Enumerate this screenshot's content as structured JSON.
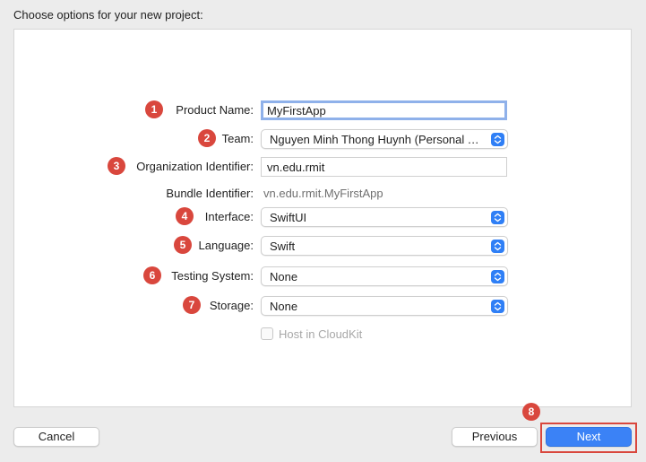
{
  "header": {
    "title": "Choose options for your new project:"
  },
  "form": {
    "product_name": {
      "step": "1",
      "label": "Product Name:",
      "value": "MyFirstApp"
    },
    "team": {
      "step": "2",
      "label": "Team:",
      "value": "Nguyen Minh Thong Huynh (Personal T..."
    },
    "organization_identifier": {
      "step": "3",
      "label": "Organization Identifier:",
      "value": "vn.edu.rmit"
    },
    "bundle_identifier": {
      "label": "Bundle Identifier:",
      "value": "vn.edu.rmit.MyFirstApp"
    },
    "interface": {
      "step": "4",
      "label": "Interface:",
      "value": "SwiftUI"
    },
    "language": {
      "step": "5",
      "label": "Language:",
      "value": "Swift"
    },
    "testing_system": {
      "step": "6",
      "label": "Testing System:",
      "value": "None"
    },
    "storage": {
      "step": "7",
      "label": "Storage:",
      "value": "None"
    },
    "host_in_cloudkit": {
      "label": "Host in CloudKit",
      "checked": false,
      "enabled": false
    }
  },
  "footer": {
    "cancel_label": "Cancel",
    "previous_label": "Previous",
    "next_label": "Next",
    "next_step": "8"
  },
  "colors": {
    "accent": "#3b82f6",
    "badge": "#d9473d",
    "focus_ring": "#8fb1ea"
  }
}
